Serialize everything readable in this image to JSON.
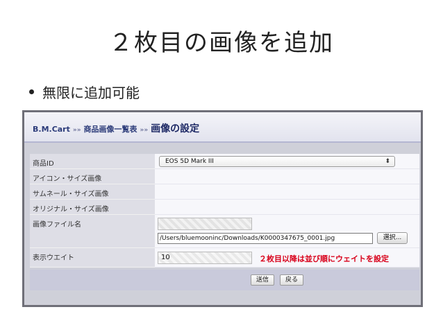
{
  "slide": {
    "title": "２枚目の画像を追加",
    "bullet": "無限に追加可能"
  },
  "app": {
    "breadcrumb": [
      "B.M.Cart",
      "商品画像一覧表",
      "画像の設定"
    ],
    "breadcrumb_sep": "»»"
  },
  "form": {
    "product_id": {
      "label": "商品ID",
      "value": "EOS 5D Mark III",
      "arrow": "⬍"
    },
    "icon_size": {
      "label": "アイコン・サイズ画像"
    },
    "thumb_size": {
      "label": "サムネール・サイズ画像"
    },
    "original_size": {
      "label": "オリジナル・サイズ画像"
    },
    "file_name": {
      "label": "画像ファイル名",
      "path": "/Users/bluemooninc/Downloads/K0000347675_0001.jpg",
      "browse_label": "選択..."
    },
    "display_weight": {
      "label": "表示ウエイト",
      "value": "10",
      "note": "２枚目以降は並び順にウェイトを設定"
    }
  },
  "buttons": {
    "send": "送信",
    "back": "戻る"
  }
}
